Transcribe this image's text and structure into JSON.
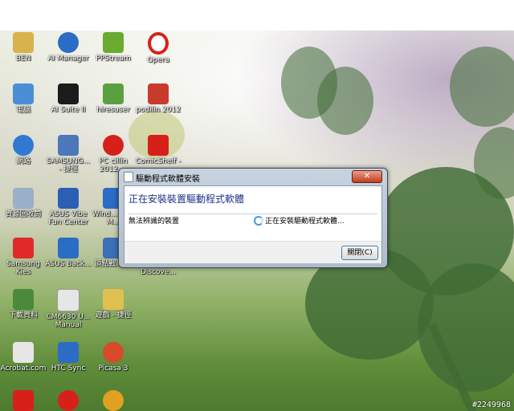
{
  "desktop_icons": [
    {
      "label": "BEN",
      "icon": "user-folder-icon",
      "color": "#d8b24a"
    },
    {
      "label": "AI Manager",
      "icon": "ai-manager-icon",
      "color": "#2b6cc4"
    },
    {
      "label": "PPStream",
      "icon": "ppstream-icon",
      "color": "#6aaa2e"
    },
    {
      "label": "Opera",
      "icon": "opera-icon",
      "color": "#d8201a"
    },
    {
      "label": "電腦",
      "icon": "computer-icon",
      "color": "#4a8fd6"
    },
    {
      "label": "AI Suite II",
      "icon": "ai-suite-icon",
      "color": "#1b1b1b"
    },
    {
      "label": "hiresuser",
      "icon": "hiresuser-icon",
      "color": "#5aa040"
    },
    {
      "label": "podilin 2012",
      "icon": "podilin-icon",
      "color": "#c83a2a"
    },
    {
      "label": "網路",
      "icon": "network-icon",
      "color": "#2f7ad0"
    },
    {
      "label": "SAMSUNG... - 捷徑",
      "icon": "samsung-icon",
      "color": "#4a78b8"
    },
    {
      "label": "PC cillin 2012 ...",
      "icon": "pc-cillin-icon",
      "color": "#d8201a"
    },
    {
      "label": "ComicShelf - ...",
      "icon": "comicshelf-icon",
      "color": "#d8201a"
    },
    {
      "label": "資源回收筒",
      "icon": "recycle-bin-icon",
      "color": "#9ab0c8"
    },
    {
      "label": "ASUS Vibe Fun Center",
      "icon": "asus-vibe-icon",
      "color": "#2b5fb4"
    },
    {
      "label": "Wind... Live M...",
      "icon": "windows-live-icon",
      "color": "#2b6cc4"
    },
    {
      "label": "Samsung Kies",
      "icon": "samsung-kies-icon",
      "color": "#e02a2a"
    },
    {
      "label": "ASUS Back...",
      "icon": "asus-backup-icon",
      "color": "#2b6cc4"
    },
    {
      "label": "頂點戰... 偵",
      "icon": "app-shortcut-icon",
      "color": "#3b6fb8"
    },
    {
      "label": "Discove...",
      "icon": "discover-icon",
      "color": "#5a7a9a"
    },
    {
      "label": "下載資料",
      "icon": "downloads-folder-icon",
      "color": "#4a8a3a"
    },
    {
      "label": "CM6630 U... Manual",
      "icon": "manual-icon",
      "color": "#e6e6e6"
    },
    {
      "label": "遊戲 - 捷徑",
      "icon": "games-folder-icon",
      "color": "#e0c050"
    },
    {
      "label": "Acrobat.com",
      "icon": "acrobat-icon",
      "color": "#e6e6e6"
    },
    {
      "label": "HTC Sync",
      "icon": "htc-sync-icon",
      "color": "#2b6cc4"
    },
    {
      "label": "Picasa 3",
      "icon": "picasa-icon",
      "color": "#d84a2a"
    },
    {
      "label": "",
      "icon": "pdf-icon",
      "color": "#d8201a"
    },
    {
      "label": "",
      "icon": "app-icon",
      "color": "#d8201a"
    },
    {
      "label": "",
      "icon": "chrome-icon",
      "color": "#e0a020"
    }
  ],
  "dialog": {
    "title": "驅動程式軟體安裝",
    "close_symbol": "✕",
    "heading": "正在安裝裝置驅動程式軟體",
    "device_name": "無法辨識的裝置",
    "status": "正在安裝驅動程式軟體...",
    "close_button_label": "關閉(C)"
  },
  "watermark": "#2249968"
}
